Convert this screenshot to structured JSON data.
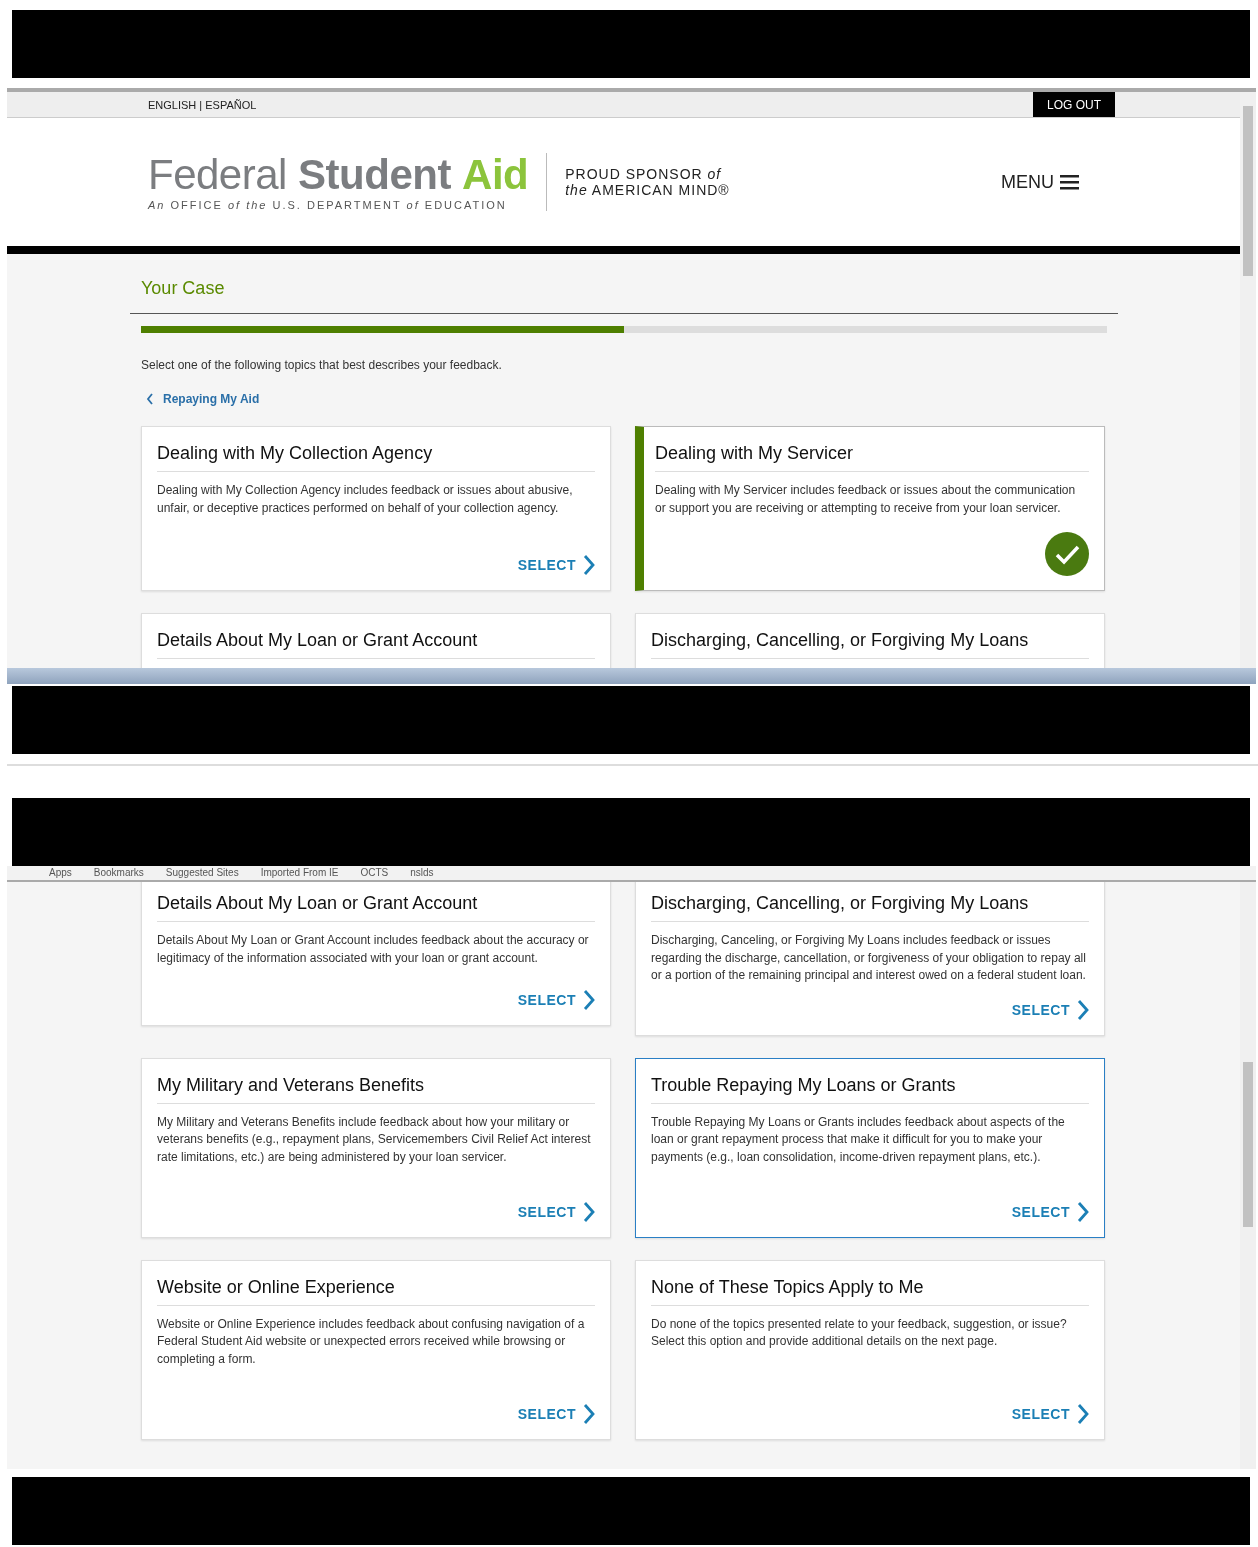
{
  "top_view": {
    "language_links": "ENGLISH | ESPAÑOL",
    "logout": "LOG OUT",
    "logo": {
      "word_1": "Federal",
      "word_2": "Student",
      "word_3": "Aid",
      "tagline": "*An* OFFICE *of the* U.S. DEPARTMENT *of* EDUCATION"
    },
    "sponsor": {
      "line_1": "PROUD SPONSOR *of*",
      "line_2": "*the* AMERICAN MIND®"
    },
    "menu": "MENU",
    "section_title": "Your Case",
    "progress": {
      "level": 0.5
    },
    "instruction": "Select one of the following topics that best describes your feedback.",
    "back_link": "Repaying My Aid",
    "topics": [
      {
        "title": "Dealing with My Collection Agency",
        "description": "Dealing with My Collection Agency includes feedback or issues about abusive, unfair, or deceptive practices performed on behalf of your collection agency.",
        "select_label": "SELECT",
        "selected": false
      },
      {
        "title": "Dealing with My Servicer",
        "description": "Dealing with My Servicer includes feedback or issues about the communication or support you are receiving or attempting to receive from your loan servicer.",
        "selected": true
      },
      {
        "title": "Details About My Loan or Grant Account",
        "selected": false
      },
      {
        "title": "Discharging, Cancelling, or Forgiving My Loans",
        "selected": false
      }
    ]
  },
  "bottom_view": {
    "bookmarks": [
      "Apps",
      "Bookmarks",
      "Suggested Sites",
      "Imported From IE",
      "OCTS",
      "nslds"
    ],
    "topics": [
      {
        "title": "Details About My Loan or Grant Account",
        "description": "Details About My Loan or Grant Account includes feedback about the accuracy or legitimacy of the information associated with your loan or grant account.",
        "select_label": "SELECT",
        "highlighted": false
      },
      {
        "title": "Discharging, Cancelling, or Forgiving My Loans",
        "description": "Discharging, Canceling, or Forgiving My Loans includes feedback or issues regarding the discharge, cancellation, or forgiveness of your obligation to repay all or a portion of the remaining principal and interest owed on a federal student loan.",
        "select_label": "SELECT",
        "highlighted": false
      },
      {
        "title": "My Military and Veterans Benefits",
        "description": "My Military and Veterans Benefits include feedback about how your military or veterans benefits (e.g., repayment plans, Servicemembers Civil Relief Act interest rate limitations, etc.) are being administered by your loan servicer.",
        "select_label": "SELECT",
        "highlighted": false
      },
      {
        "title": "Trouble Repaying My Loans or Grants",
        "description": "Trouble Repaying My Loans or Grants includes feedback about aspects of the loan or grant repayment process that make it difficult for you to make your payments (e.g., loan consolidation, income-driven repayment plans, etc.).",
        "select_label": "SELECT",
        "highlighted": true
      },
      {
        "title": "Website or Online Experience",
        "description": "Website or Online Experience includes feedback about confusing navigation of a Federal Student Aid website or unexpected errors received while browsing or completing a form.",
        "select_label": "SELECT",
        "highlighted": false
      },
      {
        "title": "None of These Topics Apply to Me",
        "description": "Do none of the topics presented relate to your feedback, suggestion, or issue? Select this option and provide additional details on the next page.",
        "select_label": "SELECT",
        "highlighted": false
      }
    ]
  }
}
